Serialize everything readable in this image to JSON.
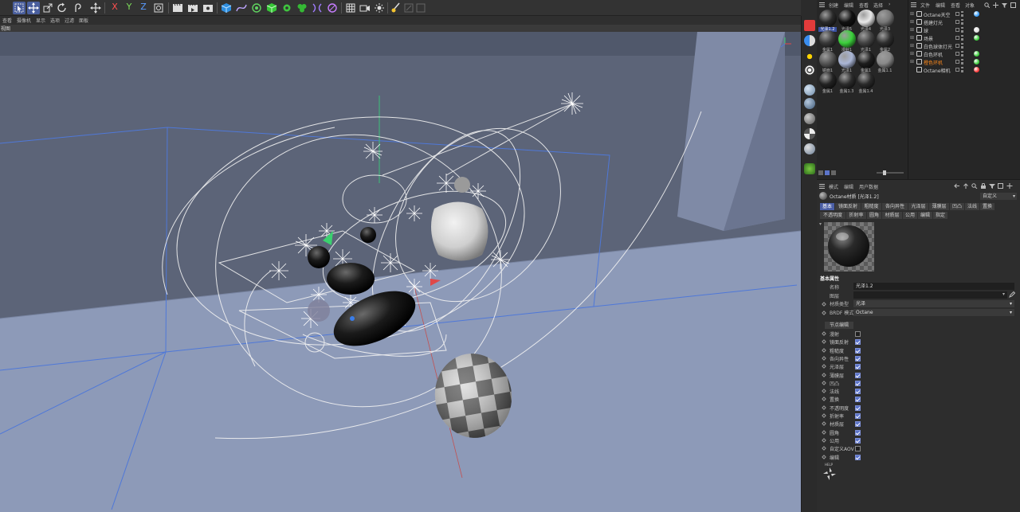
{
  "viewport": {
    "menu": [
      "查看",
      "摄像机",
      "显示",
      "选项",
      "过滤",
      "面板"
    ],
    "title": "视图"
  },
  "toolbar": {
    "axis_x": "X",
    "axis_y": "Y",
    "axis_z": "Z",
    "tools": [
      "select-icon",
      "move-icon",
      "scale-icon",
      "rotate-icon",
      "undo-icon",
      "move-cross-icon",
      "x-axis-icon",
      "y-axis-icon",
      "z-axis-icon",
      "coordinate-icon",
      "render-view-icon",
      "render-picture-icon",
      "render-settings-icon",
      "cube-icon",
      "spline-icon",
      "generator-icon",
      "deformer-icon",
      "effector-icon",
      "field-icon",
      "mograph-icon",
      "camera-icon",
      "grid-icon",
      "camera-light-icon",
      "light-icon",
      "paint-icon",
      "snap-icon"
    ]
  },
  "material_manager": {
    "menu": [
      "创建",
      "编辑",
      "查看",
      "选择"
    ],
    "materials": [
      {
        "label": "光泽1.2",
        "color": "#2a2a2a",
        "selected": true
      },
      {
        "label": "光泽5",
        "color": "#111111",
        "selected": false
      },
      {
        "label": "光泽4",
        "color": "#e9e9e9",
        "selected": false
      },
      {
        "label": "光泽3",
        "color": "#777777",
        "selected": false
      },
      {
        "label": "金属1",
        "color": "#3a3a3a",
        "selected": false
      },
      {
        "label": "漫射1",
        "color": "#3cd13c",
        "selected": false
      },
      {
        "label": "光泽1",
        "color": "#444444",
        "selected": false
      },
      {
        "label": "金属2",
        "color": "#2f2f2f",
        "selected": false
      },
      {
        "label": "镜面1",
        "color": "#555555",
        "selected": false
      },
      {
        "label": "光泽1",
        "color": "#aab6d6",
        "selected": false
      },
      {
        "label": "金属1",
        "color": "#1d1d1d",
        "selected": false
      },
      {
        "label": "金属1.1",
        "color": "#8a8a8a",
        "selected": false
      },
      {
        "label": "金属1",
        "color": "#222222",
        "selected": false
      },
      {
        "label": "金属1.3",
        "color": "#2b2b2b",
        "selected": false
      },
      {
        "label": "金属1.4",
        "color": "#2a2a2a",
        "selected": false
      }
    ]
  },
  "object_manager": {
    "menu": [
      "文件",
      "编辑",
      "查看",
      "对象"
    ],
    "objects": [
      {
        "name": "Octane天空",
        "color": "#cfcfcf",
        "tag": "#3aa0ff"
      },
      {
        "name": "搭建灯光",
        "color": "#cfcfcf",
        "tag": ""
      },
      {
        "name": "球",
        "color": "#cfcfcf",
        "tag": "#dddddd"
      },
      {
        "name": "场景",
        "color": "#cfcfcf",
        "tag": "#3fcf3f"
      },
      {
        "name": "白色球体灯光",
        "color": "#cfcfcf",
        "tag": ""
      },
      {
        "name": "白色环机",
        "color": "#cfcfcf",
        "tag": "#3fcf3f"
      },
      {
        "name": "橙色环机",
        "color": "#ff8a1c",
        "tag": "#3fcf3f"
      },
      {
        "name": "Octane相机",
        "color": "#cfcfcf",
        "tag": "#ff3b3b"
      }
    ]
  },
  "attributes": {
    "menu": [
      "模式",
      "编辑",
      "用户数据"
    ],
    "title": "Octane材质 [光泽1.2]",
    "mode": "自定义",
    "tabs_row1": [
      "基本",
      "镜面反射",
      "粗糙度",
      "各向异性",
      "光泽层",
      "薄膜层",
      "凹凸",
      "法线",
      "置换"
    ],
    "tabs_row2": [
      "不透明度",
      "折射率",
      "圆角",
      "材质层",
      "公用",
      "编辑",
      "指定"
    ],
    "section": "基本属性",
    "name_label": "名称",
    "name_value": "光泽1.2",
    "layer_label": "图层",
    "layer_value": "",
    "mat_type_label": "材质类型",
    "mat_type_value": "光泽",
    "brdf_label": "BRDF 模式",
    "brdf_value": "Octane",
    "node_button": "节点编辑",
    "channels": [
      {
        "label": "漫射",
        "checked": false
      },
      {
        "label": "镜面反射",
        "checked": true
      },
      {
        "label": "粗糙度",
        "checked": true
      },
      {
        "label": "各向异性",
        "checked": true
      },
      {
        "label": "光泽层",
        "checked": true
      },
      {
        "label": "薄膜层",
        "checked": true
      },
      {
        "label": "凹凸",
        "checked": true
      },
      {
        "label": "法线",
        "checked": true
      },
      {
        "label": "置换",
        "checked": true
      },
      {
        "label": "不透明度",
        "checked": true
      },
      {
        "label": "折射率",
        "checked": true
      },
      {
        "label": "材质层",
        "checked": true
      },
      {
        "label": "圆角",
        "checked": true
      },
      {
        "label": "公用",
        "checked": true
      },
      {
        "label": "自定义AOV",
        "checked": false
      },
      {
        "label": "编辑",
        "checked": true
      }
    ],
    "help": "HELP"
  }
}
